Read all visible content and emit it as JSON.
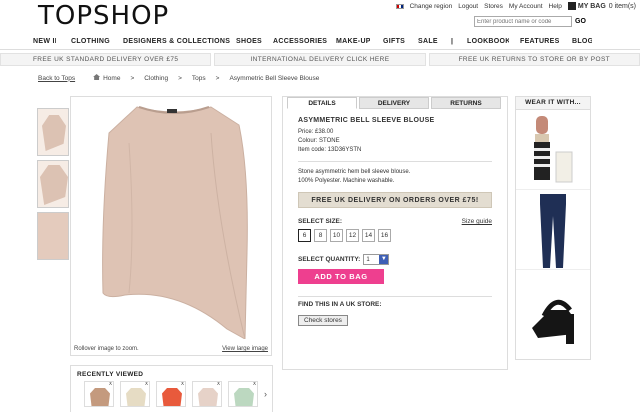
{
  "header": {
    "logo": "TOPSHOP",
    "utility_links": [
      "Change region",
      "Logout",
      "Stores",
      "My Account",
      "Help"
    ],
    "bag_label": "MY BAG",
    "bag_count": "0 item(s)",
    "search_placeholder": "Enter product name or code",
    "search_button": "GO"
  },
  "nav": [
    "NEW IN",
    "CLOTHING",
    "DESIGNERS & COLLECTIONS",
    "SHOES",
    "ACCESSORIES",
    "MAKE-UP",
    "GIFTS",
    "SALE",
    "|",
    "LOOKBOOK",
    "FEATURES",
    "BLOG"
  ],
  "promo_strip": [
    "FREE UK STANDARD DELIVERY OVER £75",
    "INTERNATIONAL DELIVERY CLICK HERE",
    "FREE UK RETURNS TO STORE OR BY POST"
  ],
  "breadcrumb": {
    "back": "Back to Tops",
    "items": [
      "Home",
      ">",
      "Clothing",
      ">",
      "Tops",
      ">",
      "Asymmetric Bell Sleeve Blouse"
    ]
  },
  "image": {
    "caption": "Rollover image to zoom.",
    "large_link": "View large image"
  },
  "tabs": [
    "DETAILS",
    "DELIVERY",
    "RETURNS"
  ],
  "product": {
    "title": "ASYMMETRIC BELL SLEEVE BLOUSE",
    "price": "Price: £38.00",
    "colour": "Colour: STONE",
    "code": "Item code: 13D36YSTN",
    "desc1": "Stone asymmetric hem bell sleeve blouse.",
    "desc2": "100% Polyester. Machine washable.",
    "promo": "FREE UK DELIVERY ON ORDERS OVER £75!",
    "size_label": "SELECT SIZE:",
    "size_guide": "Size guide",
    "sizes": [
      "6",
      "8",
      "10",
      "12",
      "14",
      "16"
    ],
    "qty_label": "SELECT QUANTITY:",
    "qty_value": "1",
    "add_to_bag": "ADD TO BAG",
    "find_label": "FIND THIS IN A UK STORE:",
    "check_stores": "Check stores"
  },
  "wear_with": {
    "title": "WEAR IT WITH..."
  },
  "recently_viewed": {
    "title": "RECENTLY VIEWED",
    "close": "x",
    "next": "›"
  },
  "colors": {
    "accent": "#ee3f8f",
    "blouse": "#dec3b4",
    "promo_bg": "#e3ddd1"
  }
}
